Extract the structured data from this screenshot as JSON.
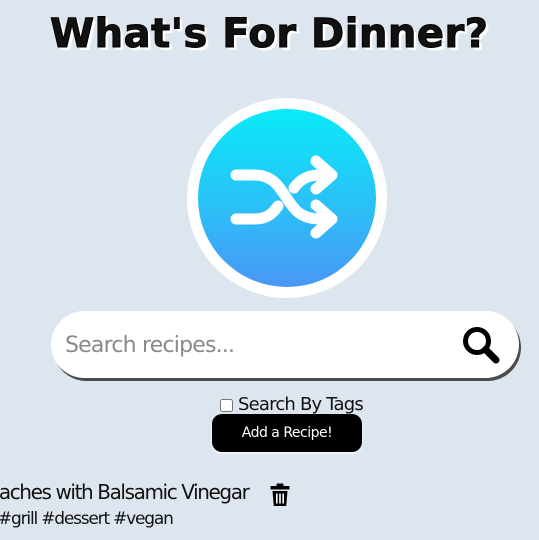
{
  "header": {
    "title": "What's For Dinner?"
  },
  "shuffle": {
    "icon": "shuffle-icon",
    "colors": [
      "#0aeaf8",
      "#4a96f6"
    ]
  },
  "search": {
    "placeholder": "Search recipes...",
    "value": "",
    "icon": "search-icon",
    "tags_toggle_label": "Search By Tags",
    "tags_toggle_checked": false
  },
  "actions": {
    "add_recipe_label": "Add a Recipe!"
  },
  "recipes": [
    {
      "title": "Peaches with Balsamic Vinegar",
      "tags": "#grill #dessert #vegan",
      "delete_icon": "trash-icon"
    }
  ]
}
